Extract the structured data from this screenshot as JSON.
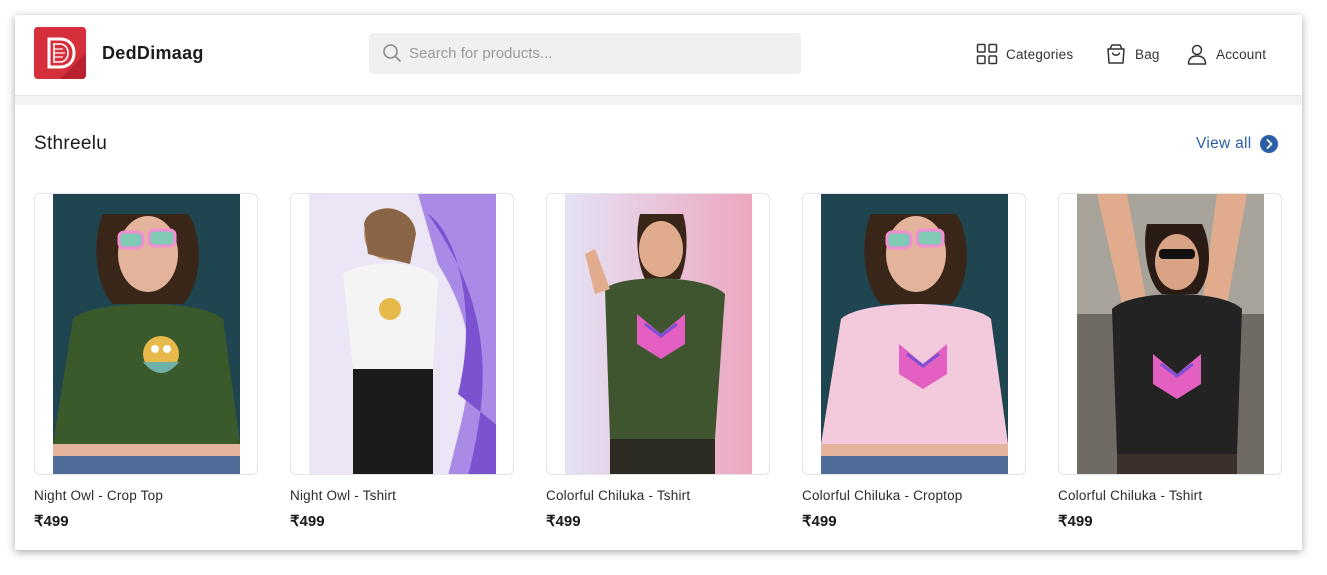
{
  "brand": {
    "name": "DedDimaag",
    "logo_color": "#d62f3c"
  },
  "search": {
    "placeholder": "Search for products..."
  },
  "nav": {
    "categories": "Categories",
    "bag": "Bag",
    "account": "Account"
  },
  "section": {
    "title": "Sthreelu",
    "view_all": "View all",
    "link_color": "#2c5ea8"
  },
  "products": [
    {
      "name": "Night Owl - Crop Top",
      "price": "₹499",
      "shirt_color": "#3b5a2c",
      "bg_color": "#1f4650",
      "graphic": "owl"
    },
    {
      "name": "Night Owl - Tshirt",
      "price": "₹499",
      "shirt_color": "#f4f4f4",
      "bg_color": "#b79ee8",
      "graphic": "owl"
    },
    {
      "name": "Colorful Chiluka - Tshirt",
      "price": "₹499",
      "shirt_color": "#3f5530",
      "bg_color": "#e7b6c8",
      "graphic": "mask"
    },
    {
      "name": "Colorful Chiluka - Croptop",
      "price": "₹499",
      "shirt_color": "#f3c9dc",
      "bg_color": "#1f4650",
      "graphic": "mask"
    },
    {
      "name": "Colorful Chiluka - Tshirt",
      "price": "₹499",
      "shirt_color": "#232323",
      "bg_color": "#6f6a63",
      "graphic": "mask"
    }
  ]
}
